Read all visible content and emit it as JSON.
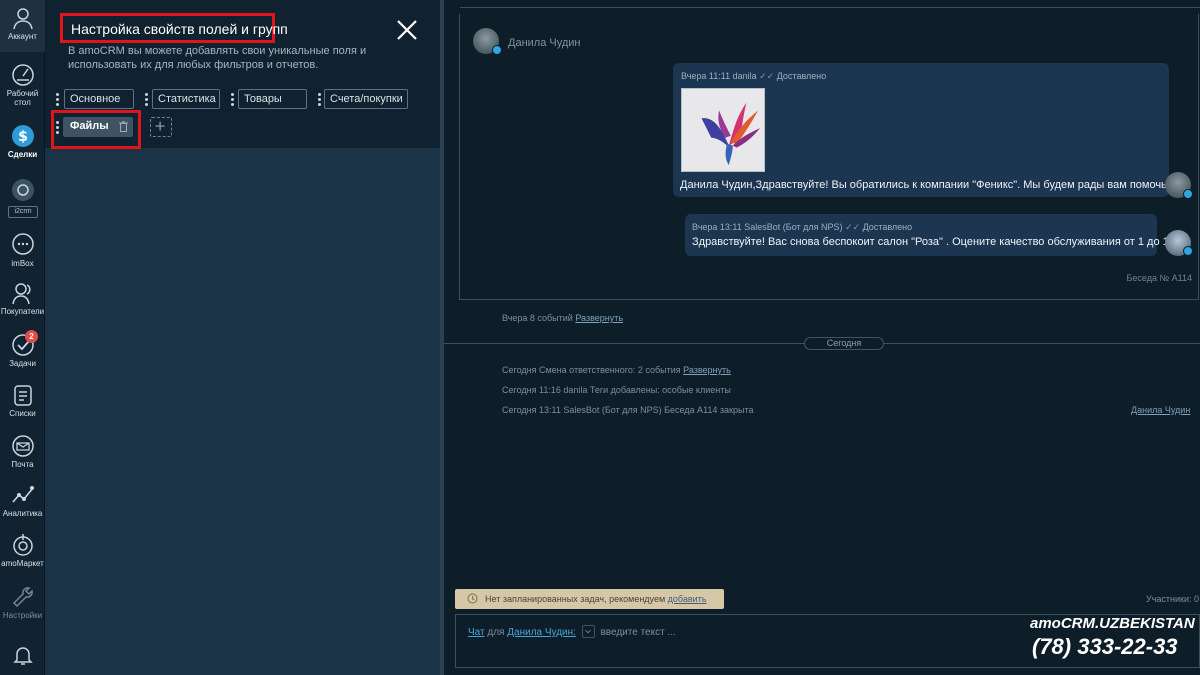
{
  "rail": {
    "items": [
      {
        "label": "Аккаунт",
        "icon": "user-icon"
      },
      {
        "label": "Рабочий\nстол",
        "icon": "dashboard-icon"
      },
      {
        "label": "Сделки",
        "icon": "deals-icon"
      },
      {
        "label": "i2crm",
        "icon": "i2crm-icon"
      },
      {
        "label": "imBox",
        "icon": "chat-icon"
      },
      {
        "label": "Покупатели",
        "icon": "customers-icon"
      },
      {
        "label": "Задачи",
        "icon": "tasks-icon"
      },
      {
        "label": "Списки",
        "icon": "lists-icon"
      },
      {
        "label": "Почта",
        "icon": "mail-icon"
      },
      {
        "label": "Аналитика",
        "icon": "analytics-icon"
      },
      {
        "label": "amoМаркет",
        "icon": "market-icon"
      },
      {
        "label": "Настройки",
        "icon": "settings-icon"
      }
    ],
    "tasks_badge": "2"
  },
  "panel": {
    "title": "Настройка свойств полей и групп",
    "description": "В amoCRM вы можете добавлять свои уникальные поля и использовать их для любых фильтров и отчетов.",
    "tabs": [
      "Основное",
      "Статистика",
      "Товары",
      "Счета/покупки"
    ],
    "active_tab": "Файлы",
    "add_tab_symbol": "+"
  },
  "chat": {
    "contact_name": "Данила Чудин",
    "messages": [
      {
        "meta": "Вчера 11:11 danila",
        "status": "Доставлено",
        "text": "Данила Чудин,Здравствуйте! Вы обратились к компании \"Феникс\". Мы будем рады вам помочь!"
      },
      {
        "meta": "Вчера 13:11 SalesBot (Бот для NPS)",
        "status": "Доставлено",
        "text": "Здравствуйте! Вас снова беспокоит салон \"Роза\" . Оцените качество обслуживания от 1 до 10"
      }
    ],
    "conversation_label": "Беседа № А114",
    "collapsed_events": {
      "text": "Вчера 8 событий",
      "link": "Развернуть"
    },
    "today_label": "Сегодня",
    "events": [
      {
        "text": "Сегодня Смена ответственного: 2 события",
        "link": "Развернуть"
      },
      {
        "text": "Сегодня 11:16 danila Теги добавлены: особые клиенты",
        "link": ""
      },
      {
        "text": "Сегодня 13:11 SalesBot (Бот для NPS) Беседа А114 закрыта",
        "link": ""
      }
    ],
    "event_right_link": "Данила Чудин",
    "task_notice": {
      "text": "Нет запланированных задач, рекомендуем",
      "link": "добавить"
    },
    "participants": "Участники: 0",
    "input": {
      "mode_link": "Чат",
      "for_text": "для",
      "recipient_link": "Данила Чудин:",
      "placeholder": "введите текст ..."
    }
  },
  "watermark": {
    "line1": "amoCRM.UZBEKISTAN",
    "line2": "(78) 333-22-33"
  },
  "colors": {
    "highlight_red": "#e0151b",
    "bubble_bg": "#1c3550",
    "panel_bg": "#1a3346",
    "telegram_blue": "#2ea6df"
  }
}
